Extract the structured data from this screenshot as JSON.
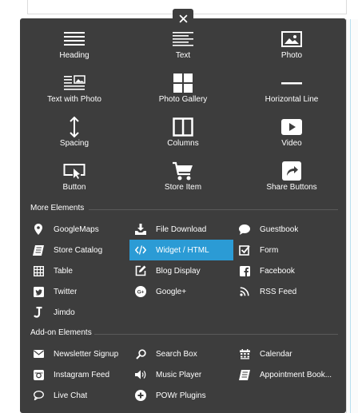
{
  "close_icon": "close-icon",
  "basic_elements": [
    {
      "label": "Heading",
      "icon": "heading-icon"
    },
    {
      "label": "Text",
      "icon": "text-icon"
    },
    {
      "label": "Photo",
      "icon": "photo-icon"
    },
    {
      "label": "Text with Photo",
      "icon": "text-with-photo-icon"
    },
    {
      "label": "Photo Gallery",
      "icon": "photo-gallery-icon"
    },
    {
      "label": "Horizontal Line",
      "icon": "horizontal-line-icon"
    },
    {
      "label": "Spacing",
      "icon": "spacing-icon"
    },
    {
      "label": "Columns",
      "icon": "columns-icon"
    },
    {
      "label": "Video",
      "icon": "video-icon"
    },
    {
      "label": "Button",
      "icon": "button-icon"
    },
    {
      "label": "Store Item",
      "icon": "cart-icon"
    },
    {
      "label": "Share Buttons",
      "icon": "share-icon"
    }
  ],
  "more_elements": {
    "title": "More Elements",
    "items": [
      {
        "label": "GoogleMaps",
        "icon": "map-pin-icon"
      },
      {
        "label": "File Download",
        "icon": "download-icon"
      },
      {
        "label": "Guestbook",
        "icon": "speech-bubble-icon"
      },
      {
        "label": "Store Catalog",
        "icon": "catalog-icon"
      },
      {
        "label": "Widget / HTML",
        "icon": "code-icon",
        "active": true
      },
      {
        "label": "Form",
        "icon": "checkbox-icon"
      },
      {
        "label": "Table",
        "icon": "table-icon"
      },
      {
        "label": "Blog Display",
        "icon": "edit-icon"
      },
      {
        "label": "Facebook",
        "icon": "facebook-icon"
      },
      {
        "label": "Twitter",
        "icon": "twitter-icon"
      },
      {
        "label": "Google+",
        "icon": "google-plus-icon"
      },
      {
        "label": "RSS Feed",
        "icon": "rss-icon"
      },
      {
        "label": "Jimdo",
        "icon": "jimdo-icon"
      }
    ]
  },
  "addon_elements": {
    "title": "Add-on Elements",
    "items": [
      {
        "label": "Newsletter Signup",
        "icon": "envelope-icon"
      },
      {
        "label": "Search Box",
        "icon": "search-icon"
      },
      {
        "label": "Calendar",
        "icon": "calendar-icon"
      },
      {
        "label": "Instagram Feed",
        "icon": "instagram-icon"
      },
      {
        "label": "Music Player",
        "icon": "speaker-icon"
      },
      {
        "label": "Appointment Book...",
        "icon": "appointment-book-icon"
      },
      {
        "label": "Live Chat",
        "icon": "chat-bubble-icon"
      },
      {
        "label": "POWr Plugins",
        "icon": "plus-circle-icon"
      }
    ]
  },
  "colors": {
    "panel_bg": "#3d3d3d",
    "active_bg": "#2b9bd5",
    "text": "#ffffff"
  }
}
